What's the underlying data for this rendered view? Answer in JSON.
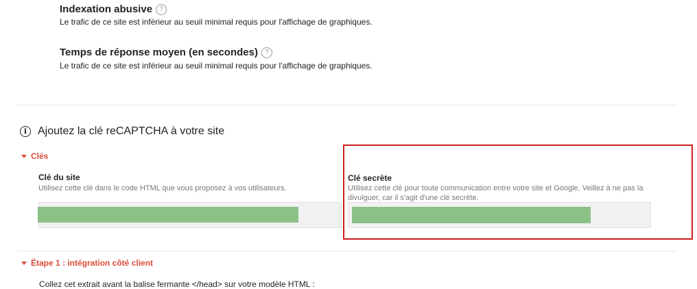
{
  "stats": [
    {
      "title": "Indexation abusive",
      "desc": "Le trafic de ce site est inférieur au seuil minimal requis pour l'affichage de graphiques.",
      "help": "?"
    },
    {
      "title": "Temps de réponse moyen (en secondes)",
      "desc": "Le trafic de ce site est inférieur au seuil minimal requis pour l'affichage de graphiques.",
      "help": "?"
    }
  ],
  "section": {
    "info": "i",
    "title": "Ajoutez la clé reCAPTCHA à votre site"
  },
  "keys": {
    "toggle_label": "Clés",
    "site_key": {
      "label": "Clé du site",
      "help": "Utilisez cette clé dans le code HTML que vous proposez à vos utilisateurs."
    },
    "secret_key": {
      "label": "Clé secrète",
      "help": "Utilisez cette clé pour toute communication entre votre site et Google. Veillez à ne pas la divulguer, car il s'agit d'une clé secrète."
    }
  },
  "step1": {
    "toggle_label": "Étape 1 : intégration côté client",
    "instruction": "Collez cet extrait avant la balise fermante </head> sur votre modèle HTML :"
  },
  "colors": {
    "accent": "#dd4b39",
    "key_redacted": "#8bc086",
    "highlight": "#cc1f1f"
  }
}
